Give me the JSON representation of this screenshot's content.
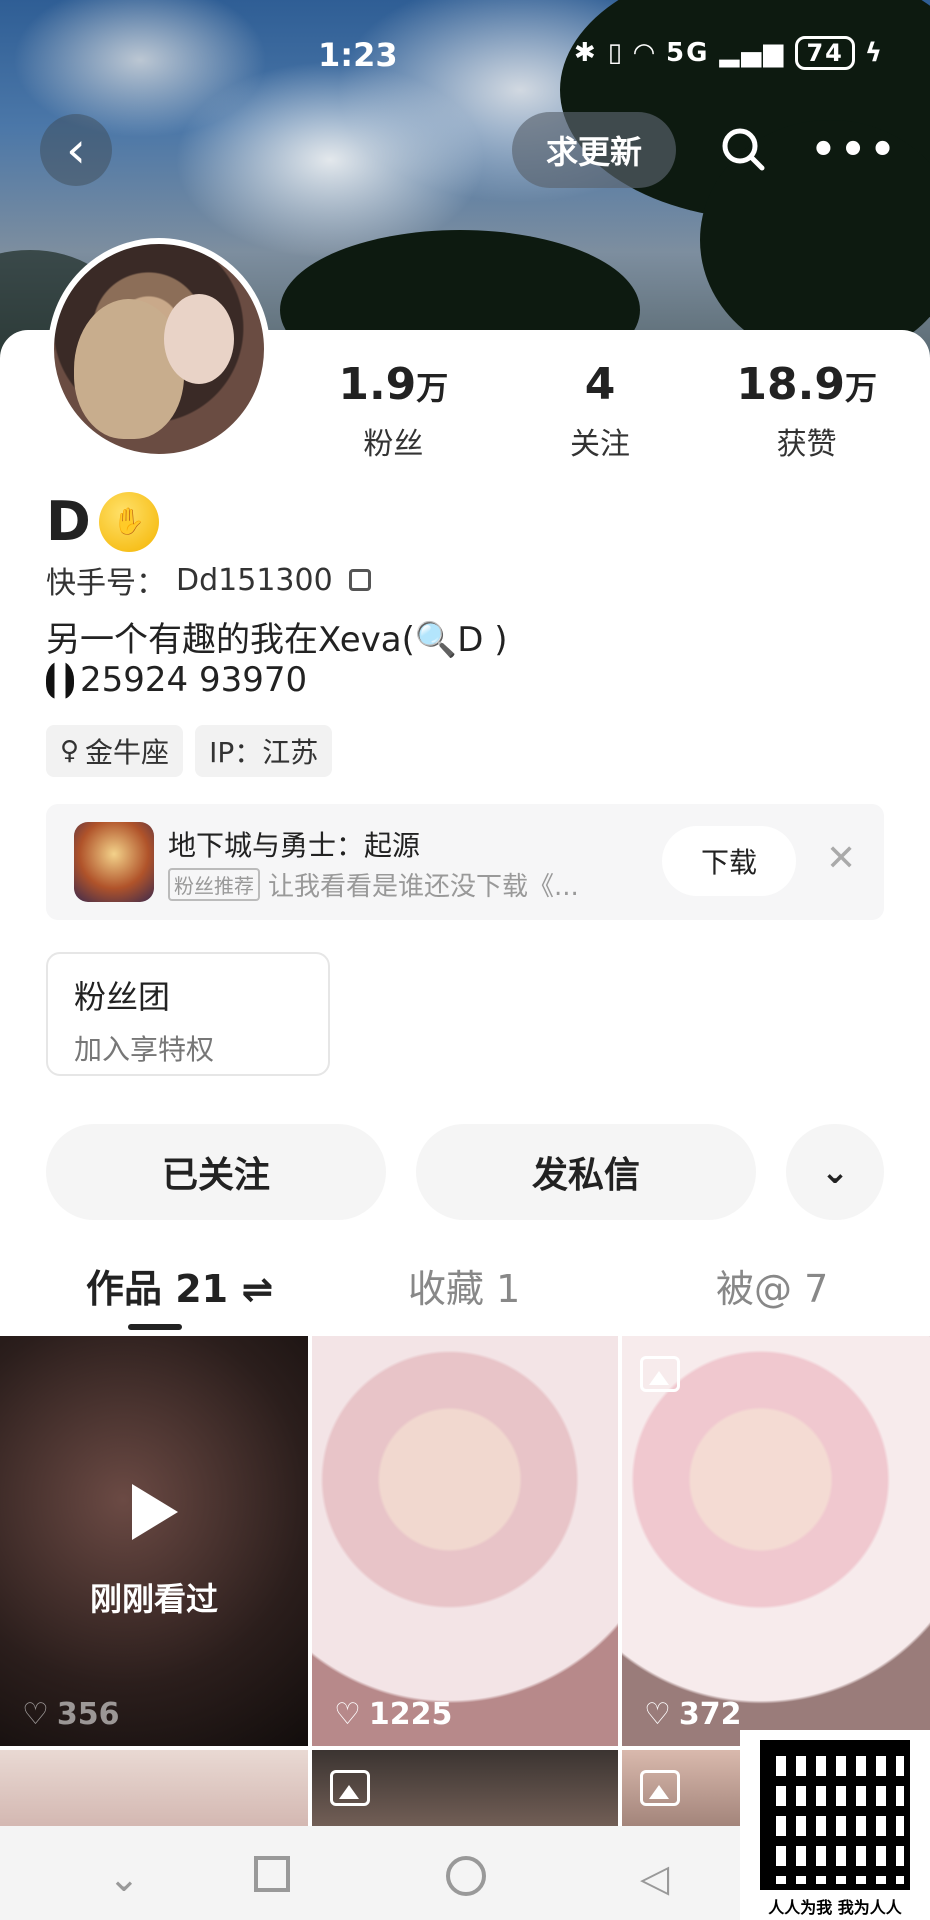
{
  "status_bar": {
    "time": "1:23",
    "network": "5G",
    "battery": "74"
  },
  "header": {
    "update_label": "求更新"
  },
  "profile": {
    "name": "D",
    "uid_label": "快手号：",
    "uid": "Dd151300",
    "bio_line1": "另一个有趣的我在Xeva(🔍D )",
    "bio_line2": "25924 93970",
    "tags": [
      "金牛座",
      "IP：江苏"
    ]
  },
  "stats": [
    {
      "num": "1.9",
      "unit": "万",
      "label": "粉丝"
    },
    {
      "num": "4",
      "unit": "",
      "label": "关注"
    },
    {
      "num": "18.9",
      "unit": "万",
      "label": "获赞"
    }
  ],
  "ad": {
    "title": "地下城与勇士：起源",
    "badge": "粉丝推荐",
    "subtitle": "让我看看是谁还没下载《...",
    "download_label": "下载",
    "close": "✕"
  },
  "fan_club": {
    "title": "粉丝团",
    "subtitle": "加入享特权"
  },
  "actions": {
    "follow_label": "已关注",
    "message_label": "发私信"
  },
  "tabs": [
    {
      "label": "作品 21 ⇌"
    },
    {
      "label": "收藏 1"
    },
    {
      "label": "被@ 7"
    }
  ],
  "grid": {
    "watched_label": "刚刚看过",
    "likes": [
      "356",
      "1225",
      "372"
    ]
  },
  "watermark": {
    "text": "人人为我 我为人人"
  }
}
